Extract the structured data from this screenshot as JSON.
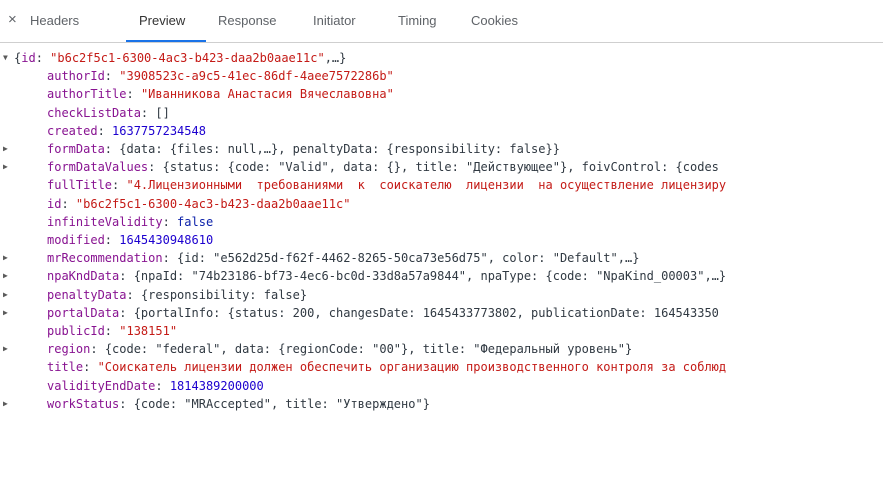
{
  "close_label": "×",
  "tabs": [
    "Headers",
    "Preview",
    "Response",
    "Initiator",
    "Timing",
    "Cookies"
  ],
  "active_tab": "Preview",
  "root": {
    "arrow": "▼",
    "brace_open": "{",
    "key": "id",
    "colon": ": ",
    "value": "\"b6c2f5c1-6300-4ac3-b423-daa2b0aae11c\"",
    "rest": ",…}"
  },
  "rows": [
    {
      "key": "authorId",
      "value": "\"3908523c-a9c5-41ec-86df-4aee7572286b\"",
      "type": "s",
      "expandable": false
    },
    {
      "key": "authorTitle",
      "value": "\"Иванникова Анастасия Вячеславовна\"",
      "type": "s",
      "expandable": false
    },
    {
      "key": "checkListData",
      "value": "[]",
      "type": "p",
      "expandable": false
    },
    {
      "key": "created",
      "value": "1637757234548",
      "type": "n",
      "expandable": false
    },
    {
      "key": "formData",
      "value": "{data: {files: null,…}, penaltyData: {responsibility: false}}",
      "type": "p",
      "expandable": true
    },
    {
      "key": "formDataValues",
      "value": "{status: {code: \"Valid\", data: {}, title: \"Действующее\"}, foivControl: {codes",
      "type": "p",
      "expandable": true
    },
    {
      "key": "fullTitle",
      "value": "\"4.Лицензионными  требованиями  к  соискателю  лицензии  на осуществление лицензиру",
      "type": "s",
      "expandable": false
    },
    {
      "key": "id",
      "value": "\"b6c2f5c1-6300-4ac3-b423-daa2b0aae11c\"",
      "type": "s",
      "expandable": false
    },
    {
      "key": "infiniteValidity",
      "value": "false",
      "type": "b",
      "expandable": false
    },
    {
      "key": "modified",
      "value": "1645430948610",
      "type": "n",
      "expandable": false
    },
    {
      "key": "mrRecommendation",
      "value": "{id: \"e562d25d-f62f-4462-8265-50ca73e56d75\", color: \"Default\",…}",
      "type": "p",
      "expandable": true
    },
    {
      "key": "npaKndData",
      "value": "{npaId: \"74b23186-bf73-4ec6-bc0d-33d8a57a9844\", npaType: {code: \"NpaKind_00003\",…}",
      "type": "p",
      "expandable": true
    },
    {
      "key": "penaltyData",
      "value": "{responsibility: false}",
      "type": "p",
      "expandable": true
    },
    {
      "key": "portalData",
      "value": "{portalInfo: {status: 200, changesDate: 1645433773802, publicationDate: 164543350",
      "type": "p",
      "expandable": true
    },
    {
      "key": "publicId",
      "value": "\"138151\"",
      "type": "s",
      "expandable": false
    },
    {
      "key": "region",
      "value": "{code: \"federal\", data: {regionCode: \"00\"}, title: \"Федеральный уровень\"}",
      "type": "p",
      "expandable": true
    },
    {
      "key": "title",
      "value": "\"Соискатель лицензии должен обеспечить организацию производственного контроля за соблюд",
      "type": "s",
      "expandable": false
    },
    {
      "key": "validityEndDate",
      "value": "1814389200000",
      "type": "n",
      "expandable": false
    },
    {
      "key": "workStatus",
      "value": "{code: \"MRAccepted\", title: \"Утверждено\"}",
      "type": "p",
      "expandable": true
    }
  ],
  "colors": {
    "key": "#881391",
    "string": "#c41a16",
    "number": "#1c00cf",
    "boolean": "#0d22aa",
    "preview": "#303942",
    "active_tab_underline": "#1a73e8"
  },
  "icons": {
    "close": "close-icon",
    "expand": "triangle-right-icon",
    "collapse": "triangle-down-icon",
    "expand_glyph": "▶"
  }
}
